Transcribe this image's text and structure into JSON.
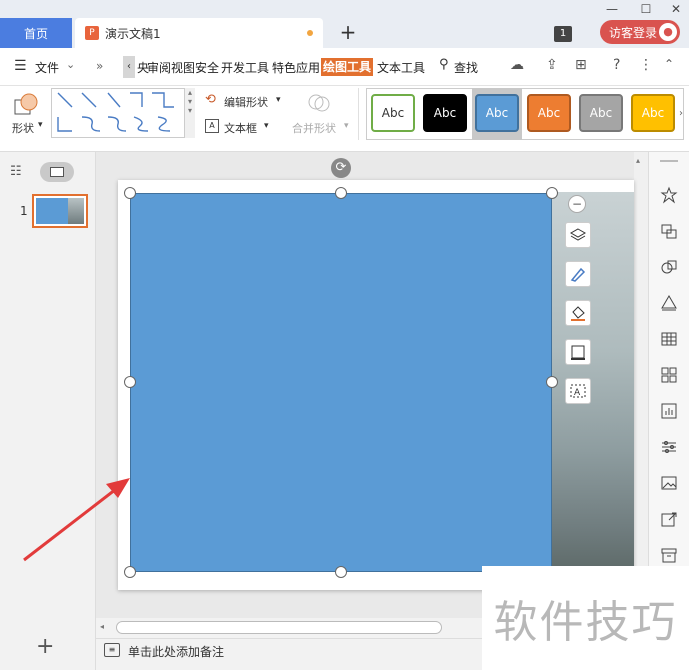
{
  "tabs": {
    "home": "首页",
    "doc_title": "演示文稿1",
    "new_tab": "+"
  },
  "window": {
    "minimize": "—",
    "maximize": "☐",
    "badge": "1",
    "login": "访客登录"
  },
  "menu": {
    "file": "文件",
    "more": "»",
    "items": [
      "审阅",
      "视图",
      "安全",
      "开发工具",
      "特色应用",
      "绘图工具",
      "文本工具"
    ],
    "partial_prefix": "央",
    "search": "查找"
  },
  "ribbon": {
    "shape": "形状",
    "edit_shape": "编辑形状",
    "text_box": "文本框",
    "merge_shape": "合并形状",
    "styles": [
      {
        "label": "Abc",
        "bg": "#ffffff",
        "fg": "#333333",
        "border": "#70ad47"
      },
      {
        "label": "Abc",
        "bg": "#000000",
        "fg": "#ffffff",
        "border": "#000000"
      },
      {
        "label": "Abc",
        "bg": "#5b9bd5",
        "fg": "#ffffff",
        "border": "#41719c"
      },
      {
        "label": "Abc",
        "bg": "#ed7d31",
        "fg": "#ffffff",
        "border": "#ae5a21"
      },
      {
        "label": "Abc",
        "bg": "#a5a5a5",
        "fg": "#ffffff",
        "border": "#787878"
      },
      {
        "label": "Abc",
        "bg": "#ffc000",
        "fg": "#ffffff",
        "border": "#bc8c00"
      }
    ]
  },
  "slides": {
    "number": "1"
  },
  "notes": {
    "placeholder": "单击此处添加备注"
  },
  "watermark": "软件技巧",
  "colors": {
    "accent": "#4b7de0",
    "draw_tab": "#e2702f",
    "shape_fill": "#5b9bd5",
    "arrow": "#e23b3b"
  }
}
